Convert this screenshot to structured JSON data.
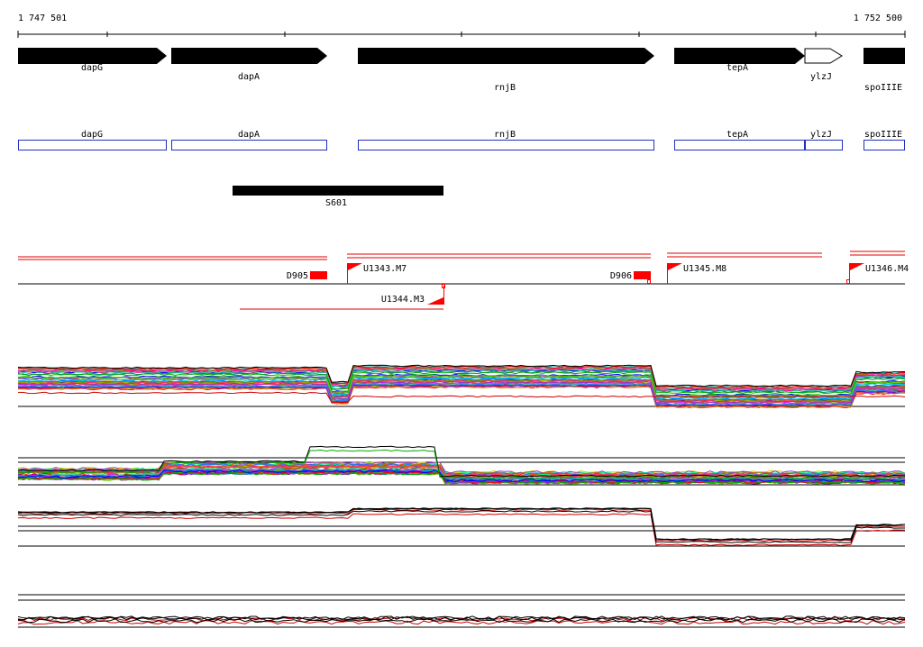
{
  "ruler": {
    "start_label": "1 747 501",
    "end_label": "1 752 500"
  },
  "genes": [
    {
      "name": "dapG",
      "strand": "+",
      "style": "filled"
    },
    {
      "name": "dapA",
      "strand": "+",
      "style": "filled"
    },
    {
      "name": "rnjB",
      "strand": "+",
      "style": "filled"
    },
    {
      "name": "tepA",
      "strand": "+",
      "style": "filled"
    },
    {
      "name": "ylzJ",
      "strand": "+",
      "style": "outline"
    },
    {
      "name": "spoIIIE",
      "strand": "+",
      "style": "filled"
    }
  ],
  "cds_boxes": [
    "dapG",
    "dapA",
    "rnjB",
    "tepA",
    "ylzJ",
    "spoIIIE"
  ],
  "segments": [
    {
      "name": "S601"
    }
  ],
  "features": [
    {
      "name": "D905",
      "kind": "block"
    },
    {
      "name": "U1343.M7",
      "kind": "flag"
    },
    {
      "name": "D906",
      "kind": "block"
    },
    {
      "name": "U1345.M8",
      "kind": "flag"
    },
    {
      "name": "U1346.M4",
      "kind": "flag"
    },
    {
      "name": "U1344.M3",
      "kind": "flag-reverse"
    }
  ],
  "colors": {
    "gene": "#000000",
    "cds_outline": "#1f2fbf",
    "feature": "#ff0000",
    "axis": "#000000"
  },
  "tracks": [
    {
      "name": "expression-profiles-all-conditions",
      "style": "multicolor"
    },
    {
      "name": "expression-profiles-set-2",
      "style": "multicolor"
    },
    {
      "name": "expression-profiles-summary-1",
      "style": "black-red"
    },
    {
      "name": "expression-profiles-summary-2",
      "style": "black-red"
    }
  ]
}
